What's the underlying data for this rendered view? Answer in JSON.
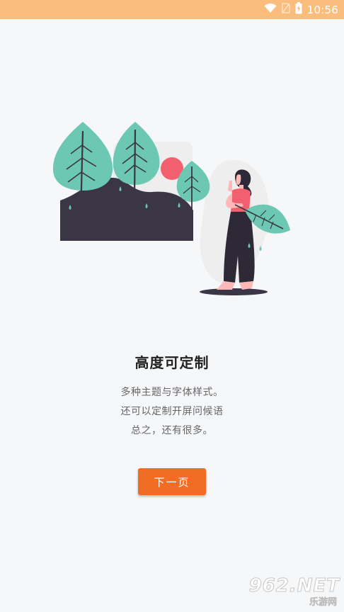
{
  "status_bar": {
    "time": "10:56",
    "background_color": "#fbbd7c",
    "icons": [
      "wifi-icon",
      "sim-icon",
      "battery-icon"
    ]
  },
  "onboarding": {
    "title": "高度可定制",
    "description_lines": [
      "多种主题与字体样式。",
      "还可以定制开屏问候语",
      "总之，还有很多。"
    ],
    "next_button_label": "下一页",
    "accent_color": "#f26d24"
  },
  "illustration": {
    "name": "trees-and-woman-illustration",
    "colors": {
      "leaf": "#6cc8b3",
      "hill": "#3a3646",
      "sun": "#f25f6f",
      "shirt": "#f25f6f"
    }
  },
  "watermark": {
    "main": "962.NET",
    "sub": "乐游网"
  }
}
